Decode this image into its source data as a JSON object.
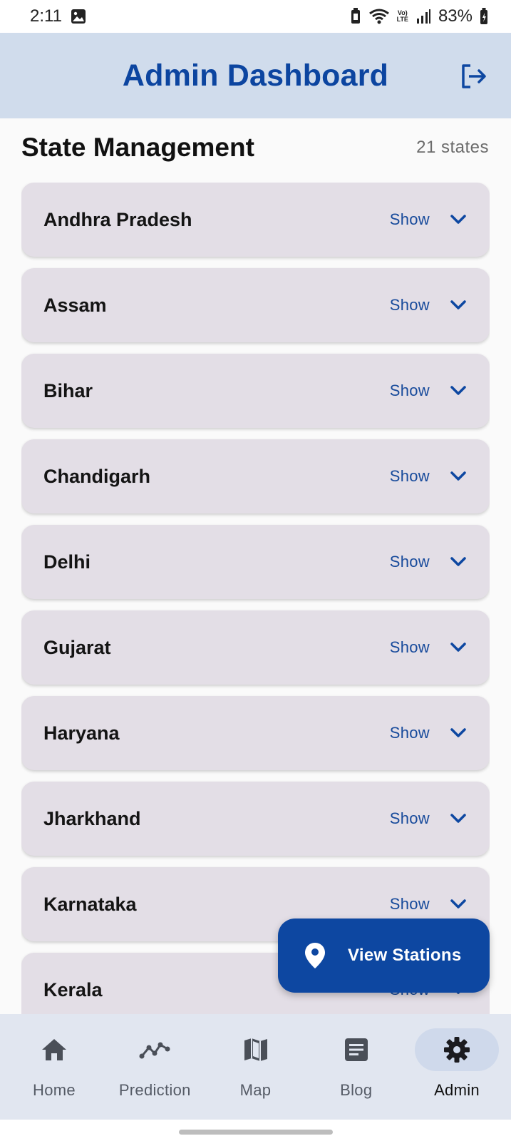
{
  "status_bar": {
    "time": "2:11",
    "battery": "83%",
    "network_badge_top": "Vo)",
    "network_badge_bottom": "LTE"
  },
  "header": {
    "title": "Admin Dashboard",
    "logout_icon": "logout-icon"
  },
  "section": {
    "title": "State Management",
    "count": "21 states"
  },
  "states": [
    {
      "name": "Andhra Pradesh",
      "action": "Show"
    },
    {
      "name": "Assam",
      "action": "Show"
    },
    {
      "name": "Bihar",
      "action": "Show"
    },
    {
      "name": "Chandigarh",
      "action": "Show"
    },
    {
      "name": "Delhi",
      "action": "Show"
    },
    {
      "name": "Gujarat",
      "action": "Show"
    },
    {
      "name": "Haryana",
      "action": "Show"
    },
    {
      "name": "Jharkhand",
      "action": "Show"
    },
    {
      "name": "Karnataka",
      "action": "Show"
    },
    {
      "name": "Kerala",
      "action": "Show"
    }
  ],
  "fab": {
    "label": "View Stations",
    "icon": "location-pin-icon"
  },
  "bottom_nav": {
    "items": [
      {
        "label": "Home",
        "icon": "home-icon"
      },
      {
        "label": "Prediction",
        "icon": "trend-icon"
      },
      {
        "label": "Map",
        "icon": "map-icon"
      },
      {
        "label": "Blog",
        "icon": "article-icon"
      },
      {
        "label": "Admin",
        "icon": "settings-icon"
      }
    ],
    "active": "Admin"
  },
  "colors": {
    "primary": "#0d47a1",
    "header_bg": "#d0dcec",
    "card_bg": "#e3dee6",
    "nav_bg": "#e1e6f0"
  }
}
